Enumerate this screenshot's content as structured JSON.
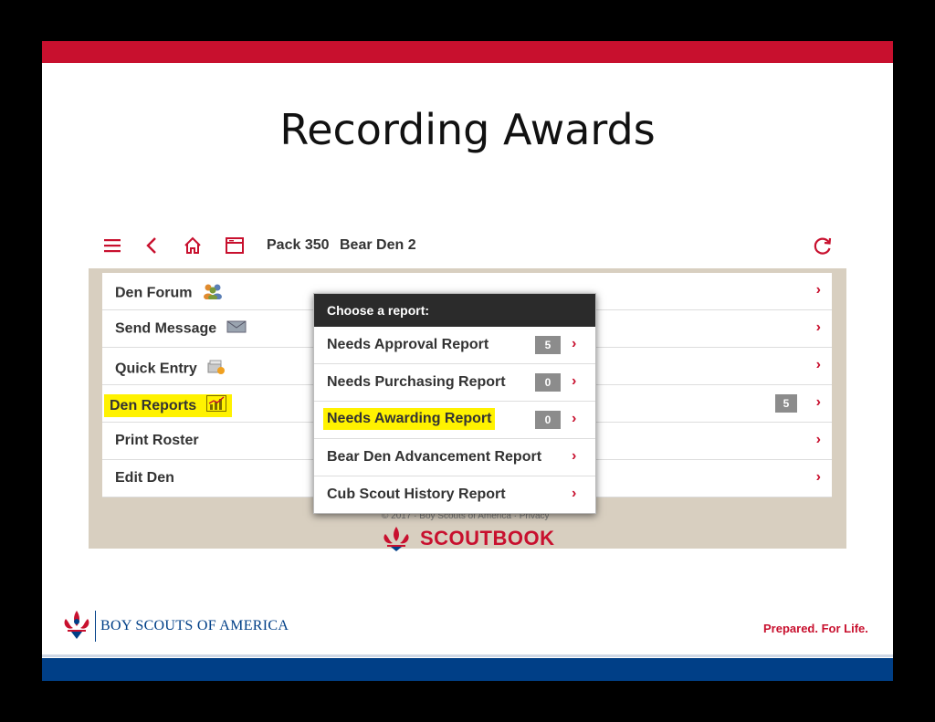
{
  "slide": {
    "title": "Recording Awards",
    "colors": {
      "top_bar": "#c8102e",
      "bottom_bar": "#003f87"
    }
  },
  "app_header": {
    "icons": [
      "menu-icon",
      "back-icon",
      "home-icon",
      "window-icon",
      "refresh-icon"
    ],
    "pack": "Pack 350",
    "den": "Bear Den 2"
  },
  "menu": {
    "items": [
      {
        "label": "Den Forum",
        "icon": "people-icon"
      },
      {
        "label": "Send Message",
        "icon": "envelope-icon"
      },
      {
        "label": "Quick Entry",
        "icon": "quick-entry-icon"
      },
      {
        "label": "Den Reports",
        "icon": "chart-icon",
        "badge": "5"
      },
      {
        "label": "Print Roster"
      },
      {
        "label": "Edit Den"
      }
    ]
  },
  "popup": {
    "header": "Choose a report:",
    "items": [
      {
        "label": "Needs Approval Report",
        "badge": "5"
      },
      {
        "label": "Needs Purchasing Report",
        "badge": "0"
      },
      {
        "label": "Needs Awarding Report",
        "badge": "0"
      },
      {
        "label": "Bear Den Advancement Report"
      },
      {
        "label": "Cub Scout History Report"
      }
    ]
  },
  "footer": {
    "copyright": "© 2017 · Boy Scouts of America · Privacy",
    "brand": "SCOUTBOOK"
  },
  "bsa": {
    "name": "BOY SCOUTS OF AMERICA",
    "tagline": "Prepared. For Life."
  }
}
